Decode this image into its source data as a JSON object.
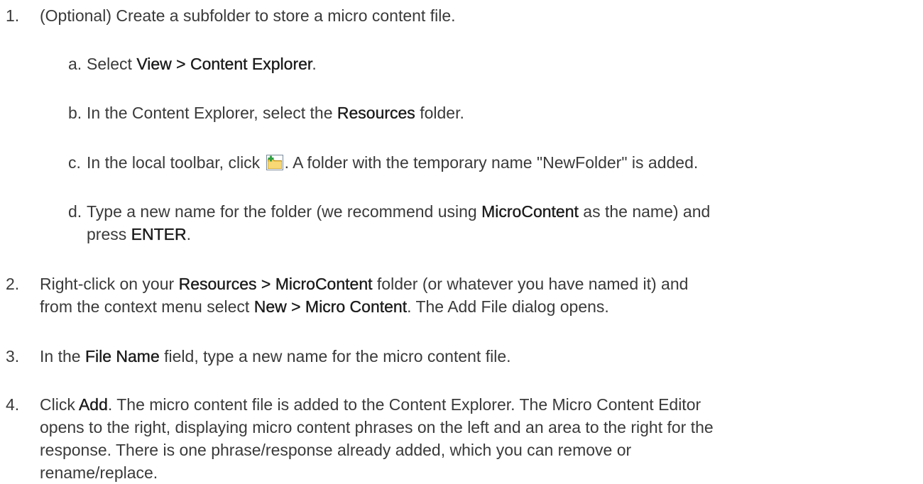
{
  "steps": [
    {
      "number": "1.",
      "text": "(Optional) Create a subfolder to store a micro content file.",
      "substeps": [
        {
          "letter": "a.",
          "pre": "Select ",
          "bold": "View > Content Explorer",
          "post": "."
        },
        {
          "letter": "b.",
          "pre": "In the Content Explorer, select the ",
          "bold": "Resources",
          "post": " folder."
        },
        {
          "letter": "c.",
          "pre": "In the local toolbar, click ",
          "icon": "new-folder-icon",
          "post": ". A folder with the temporary name \"NewFolder\" is added."
        },
        {
          "letter": "d.",
          "line1_pre": "Type a new name for the folder (we recommend using ",
          "line1_bold": "MicroContent",
          "line1_post": " as the name) and",
          "line2_pre": "press ",
          "line2_bold": "ENTER",
          "line2_post": "."
        }
      ]
    },
    {
      "number": "2.",
      "line1_pre": "Right-click on your ",
      "line1_bold": "Resources > MicroContent",
      "line1_post": " folder (or whatever you have named it) and",
      "line2_pre": "from the context menu select ",
      "line2_bold": "New > Micro Content",
      "line2_post": ". The Add File dialog opens."
    },
    {
      "number": "3.",
      "pre": "In the ",
      "bold": "File Name",
      "post": " field, type a new name for the micro content file."
    },
    {
      "number": "4.",
      "line1_pre": "Click ",
      "line1_bold": "Add",
      "line1_post": ". The micro content file is added to the Content Explorer. The Micro Content Editor",
      "line2": "opens to the right, displaying micro content phrases on the left and an area to the right for the",
      "line3": "response. There is one phrase/response already added, which you can remove or",
      "line4": "rename/replace."
    }
  ],
  "colors": {
    "text": "#3a3a3a",
    "bold_text": "#1a1a1a",
    "icon_folder": "#f2c94c",
    "icon_plus": "#2ea043"
  }
}
